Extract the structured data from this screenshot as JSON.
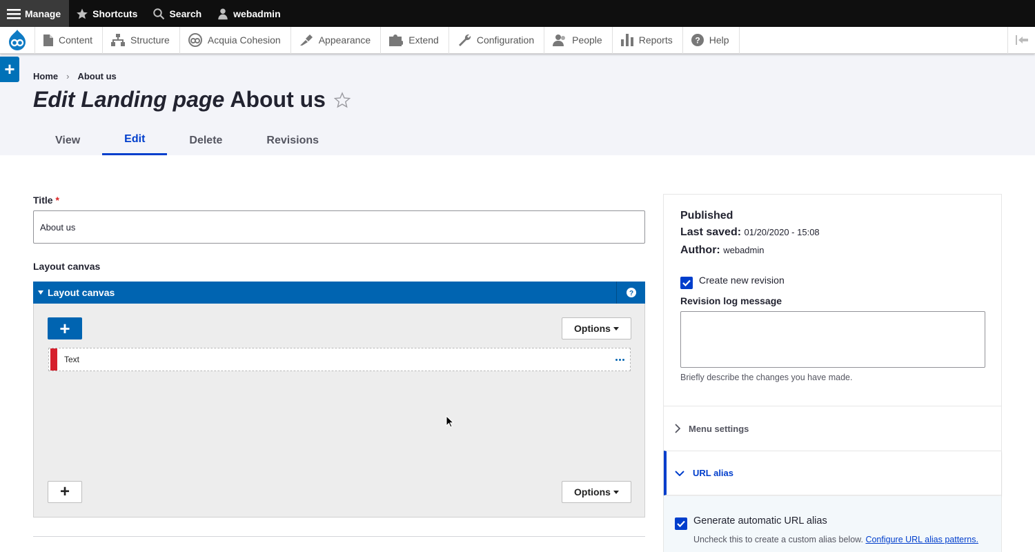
{
  "toolbar": {
    "manage": "Manage",
    "shortcuts": "Shortcuts",
    "search": "Search",
    "user": "webadmin"
  },
  "tray": {
    "items": [
      "Content",
      "Structure",
      "Acquia Cohesion",
      "Appearance",
      "Extend",
      "Configuration",
      "People",
      "Reports",
      "Help"
    ]
  },
  "breadcrumb": {
    "home": "Home",
    "separator": "›",
    "current": "About us"
  },
  "page": {
    "title_prefix": "Edit Landing page",
    "title_name": "About us"
  },
  "tabs": [
    "View",
    "Edit",
    "Delete",
    "Revisions"
  ],
  "form": {
    "title_label": "Title",
    "title_required_marker": "*",
    "title_value": "About us",
    "layout_label": "Layout canvas",
    "canvas_header": "Layout canvas",
    "add_glyph": "+",
    "options_label": "Options",
    "element_label": "Text"
  },
  "sidebar": {
    "status": "Published",
    "last_saved_label": "Last saved:",
    "last_saved_value": "01/20/2020 - 15:08",
    "author_label": "Author:",
    "author_value": "webadmin",
    "create_revision": "Create new revision",
    "revision_log_label": "Revision log message",
    "revision_hint": "Briefly describe the changes you have made.",
    "menu_settings": "Menu settings",
    "url_alias": "URL alias",
    "generate_alias": "Generate automatic URL alias",
    "alias_hint": "Uncheck this to create a custom alias below.",
    "alias_link": "Configure URL alias patterns."
  },
  "colors": {
    "accent": "#003ecc",
    "canvas_blue": "#0064b1",
    "header_bg": "#f3f4f9",
    "element_bar": "#d6202d"
  }
}
